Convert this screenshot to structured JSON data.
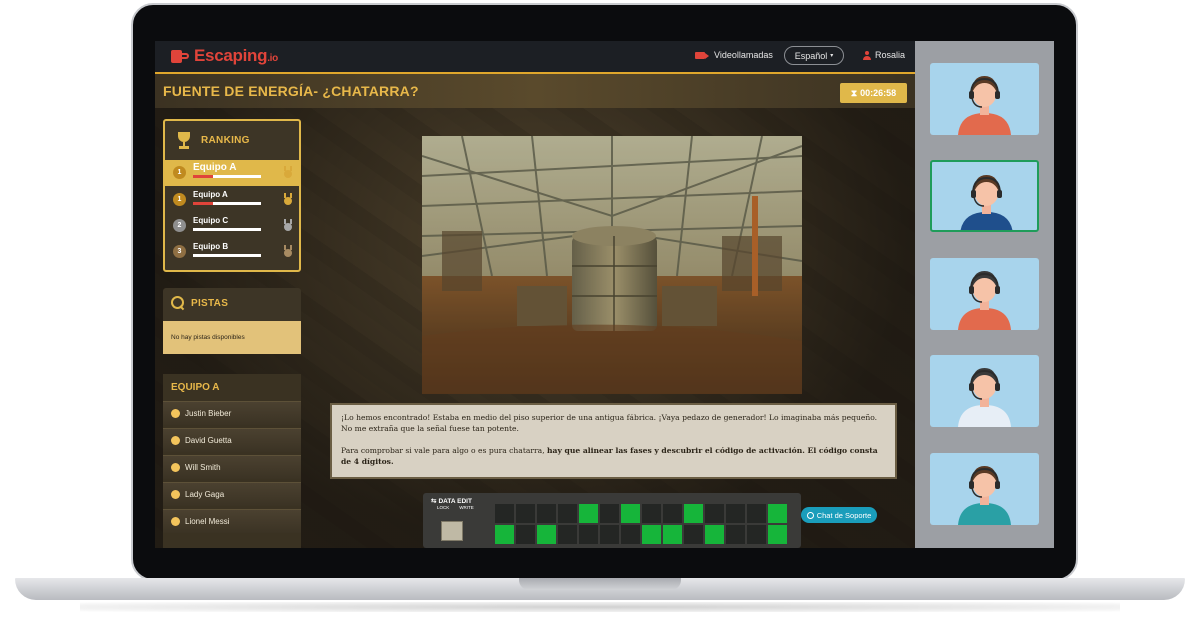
{
  "app": {
    "logo_text": "Escaping",
    "logo_suffix": ".io"
  },
  "nav": {
    "videocalls_label": "Videollamadas",
    "language_label": "Español",
    "user_label": "Rosalia"
  },
  "header": {
    "title": "Fuente de energía- ¿Chatarra?",
    "timer": "00:26:58"
  },
  "ranking": {
    "label": "Ranking",
    "rows": [
      {
        "pos": "1",
        "name": "Equipo A",
        "progress": 0.3,
        "highlight": true,
        "badge_color": "#c08a1f",
        "medal_color": "#d9a93a"
      },
      {
        "pos": "1",
        "name": "Equipo A",
        "progress": 0.3,
        "highlight": false,
        "badge_color": "#c08a1f",
        "medal_color": "#d9a93a"
      },
      {
        "pos": "2",
        "name": "Equipo C",
        "progress": 0.0,
        "highlight": false,
        "badge_color": "#8f8f8f",
        "medal_color": "#a7a7a7"
      },
      {
        "pos": "3",
        "name": "Equipo B",
        "progress": 0.0,
        "highlight": false,
        "badge_color": "#8f6f43",
        "medal_color": "#a88b62"
      }
    ]
  },
  "pistas": {
    "label": "Pistas",
    "empty_text": "No hay pistas disponibles"
  },
  "team": {
    "label": "Equipo A",
    "members": [
      "Justin Bieber",
      "David Guetta",
      "Will Smith",
      "Lady Gaga",
      "Lionel Messi"
    ]
  },
  "story": {
    "p1": "¡Lo hemos encontrado! Estaba en medio del piso superior de una antigua fábrica. ¡Vaya pedazo de generador! Lo imaginaba más pequeño. No me extraña que la señal fuese tan potente.",
    "p2_start": "Para comprobar si vale para algo o es pura chatarra, ",
    "p2_bold": "hay que alinear las fases y descubrir el código de activación. El código consta de 4 dígitos."
  },
  "puzzle": {
    "ctrl_title": "DATA EDIT",
    "lock_label": "LOCK",
    "write_label": "WRITE",
    "row1": [
      0,
      0,
      0,
      0,
      1,
      0,
      1,
      0,
      0,
      1,
      0,
      0,
      0,
      1
    ],
    "row2": [
      1,
      0,
      1,
      0,
      0,
      0,
      0,
      1,
      1,
      0,
      1,
      0,
      0,
      1
    ]
  },
  "chat": {
    "label": "Chat de Soporte"
  },
  "colors": {
    "accent": "#e0b84a",
    "brand": "#e0443a",
    "cell_on": "#16b53a",
    "chat": "#1a9dbb"
  },
  "video_tiles": [
    {
      "name": "participant-1",
      "shirt": "#e26a4d",
      "hair": "#5a3a24",
      "active": false
    },
    {
      "name": "participant-2",
      "shirt": "#1f4f8c",
      "hair": "#5a3a24",
      "active": true
    },
    {
      "name": "participant-3",
      "shirt": "#e26a4d",
      "hair": "#3a3a3a",
      "active": false
    },
    {
      "name": "participant-4",
      "shirt": "#e7eef6",
      "hair": "#3a3a3a",
      "active": false
    },
    {
      "name": "participant-5",
      "shirt": "#2aa0a5",
      "hair": "#5a3a24",
      "active": false
    }
  ]
}
